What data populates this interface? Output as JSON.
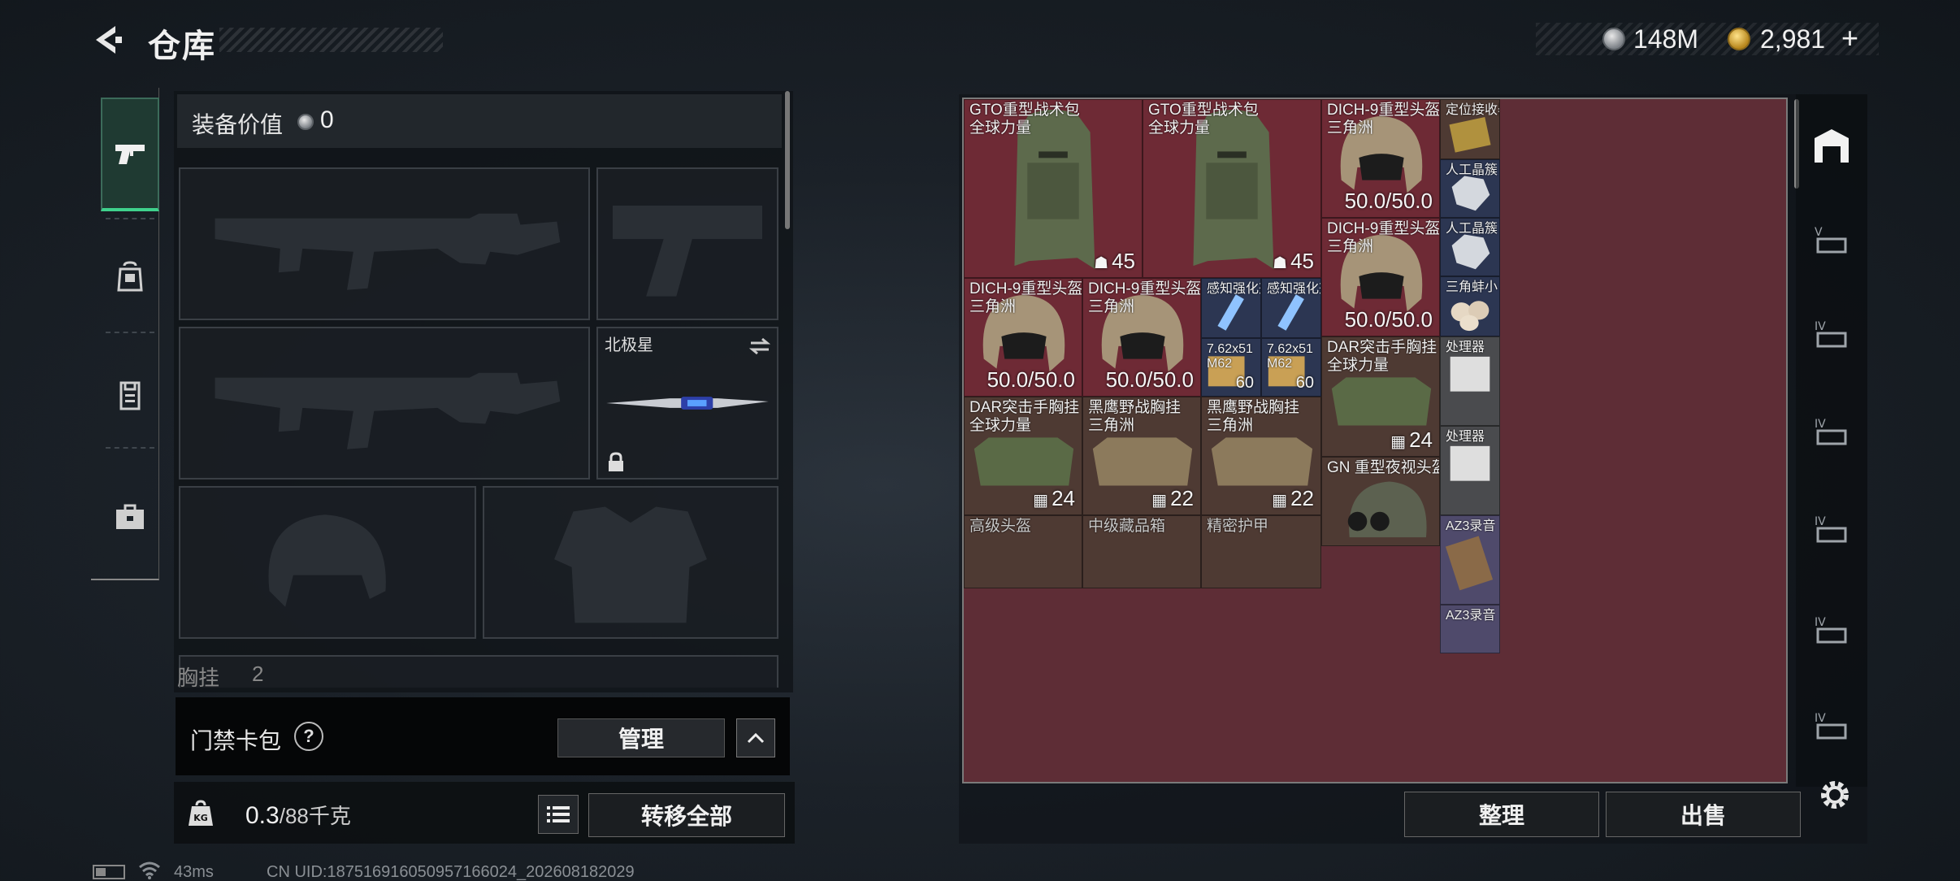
{
  "header": {
    "title": "仓库"
  },
  "currency": {
    "silver": "148M",
    "gold": "2,981",
    "gold_add": "+"
  },
  "equipment": {
    "value_label": "装备价值",
    "value": "0",
    "melee_slot_label": "北极星",
    "chest_rig_partial": "胸挂",
    "chest_rig_partial_count": "2"
  },
  "access_card": {
    "label": "门禁卡包",
    "help": "?",
    "manage_label": "管理"
  },
  "weight": {
    "current": "0.3",
    "max_text": "/88千克"
  },
  "actions": {
    "transfer_all": "转移全部",
    "sort": "整理",
    "sell": "出售"
  },
  "status": {
    "ping": "43ms",
    "uid": "CN UID:1875169160509571660​24_202608182029"
  },
  "tabs": [
    "weapons",
    "backpack",
    "armor",
    "toolbox"
  ],
  "inventory": [
    {
      "name": "GTO重型战术包",
      "sub": "全球力量",
      "value": "45",
      "value_kind": "capacity"
    },
    {
      "name": "GTO重型战术包",
      "sub": "全球力量",
      "value": "45",
      "value_kind": "capacity"
    },
    {
      "name": "DICH-9重型头盔",
      "sub": "三角洲",
      "value": "50.0/50.0",
      "value_kind": "durability"
    },
    {
      "name": "定位接收器",
      "sub": "",
      "value": "",
      "value_kind": ""
    },
    {
      "name": "人工晶簇",
      "sub": "",
      "value": "",
      "value_kind": ""
    },
    {
      "name": "DICH-9重型头盔",
      "sub": "三角洲",
      "value": "50.0/50.0",
      "value_kind": "durability"
    },
    {
      "name": "人工晶簇",
      "sub": "",
      "value": "",
      "value_kind": ""
    },
    {
      "name": "三角蚌小",
      "sub": "",
      "value": "",
      "value_kind": ""
    },
    {
      "name": "DICH-9重型头盔",
      "sub": "三角洲",
      "value": "50.0/50.0",
      "value_kind": "durability"
    },
    {
      "name": "DICH-9重型头盔",
      "sub": "三角洲",
      "value": "50.0/50.0",
      "value_kind": "durability"
    },
    {
      "name": "感知强化剂",
      "sub": "",
      "value": "",
      "value_kind": ""
    },
    {
      "name": "感知强化剂",
      "sub": "",
      "value": "",
      "value_kind": ""
    },
    {
      "name": "7.62x51",
      "sub": "M62",
      "value": "60",
      "value_kind": "count"
    },
    {
      "name": "7.62x51",
      "sub": "M62",
      "value": "60",
      "value_kind": "count"
    },
    {
      "name": "DAR突击手胸挂",
      "sub": "全球力量",
      "value": "24",
      "value_kind": "capacity"
    },
    {
      "name": "处理器",
      "sub": "",
      "value": "",
      "value_kind": ""
    },
    {
      "name": "处理器",
      "sub": "",
      "value": "",
      "value_kind": ""
    },
    {
      "name": "DAR突击手胸挂",
      "sub": "全球力量",
      "value": "24",
      "value_kind": "capacity"
    },
    {
      "name": "黑鹰野战胸挂",
      "sub": "三角洲",
      "value": "22",
      "value_kind": "capacity"
    },
    {
      "name": "黑鹰野战胸挂",
      "sub": "三角洲",
      "value": "22",
      "value_kind": "capacity"
    },
    {
      "name": "GN 重型夜视头盔",
      "sub": "",
      "value": "",
      "value_kind": ""
    },
    {
      "name": "AZ3录音",
      "sub": "",
      "value": "",
      "value_kind": ""
    },
    {
      "name": "AZ3录音",
      "sub": "",
      "value": "",
      "value_kind": ""
    },
    {
      "name": "高级头盔",
      "sub": "",
      "value": "",
      "value_kind": ""
    },
    {
      "name": "中级藏品箱",
      "sub": "",
      "value": "",
      "value_kind": ""
    },
    {
      "name": "精密护甲",
      "sub": "",
      "value": "",
      "value_kind": ""
    }
  ],
  "colors": {
    "rarity_red": "#6e2a35",
    "rarity_brown": "#4e3a33",
    "rarity_navy": "#2c3652",
    "rarity_purple": "#4f4a6b",
    "accent_green": "#3fd18c"
  }
}
